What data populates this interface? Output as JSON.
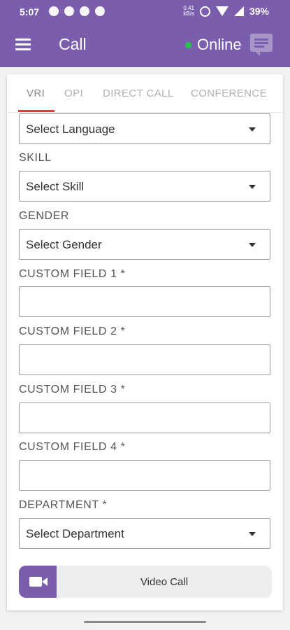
{
  "status_bar": {
    "time": "5:07",
    "network_speed_top": "0.41",
    "network_speed_bottom": "kB/s",
    "battery": "39%"
  },
  "app_bar": {
    "title": "Call",
    "status_text": "Online",
    "status_color": "#27c24c",
    "brand_color": "#7b5dae"
  },
  "tabs": [
    {
      "label": "VRI",
      "active": true
    },
    {
      "label": "OPI",
      "active": false
    },
    {
      "label": "DIRECT CALL",
      "active": false
    },
    {
      "label": "CONFERENCE",
      "active": false
    }
  ],
  "form": {
    "language": {
      "value": "Select Language"
    },
    "skill": {
      "label": "SKILL",
      "value": "Select Skill"
    },
    "gender": {
      "label": "GENDER",
      "value": "Select Gender"
    },
    "custom1": {
      "label": "CUSTOM FIELD 1 *",
      "value": ""
    },
    "custom2": {
      "label": "CUSTOM FIELD 2 *",
      "value": ""
    },
    "custom3": {
      "label": "CUSTOM FIELD 3 *",
      "value": ""
    },
    "custom4": {
      "label": "CUSTOM FIELD 4 *",
      "value": ""
    },
    "department": {
      "label": "DEPARTMENT *",
      "value": "Select Department"
    }
  },
  "video_call_button": {
    "label": "Video Call"
  }
}
